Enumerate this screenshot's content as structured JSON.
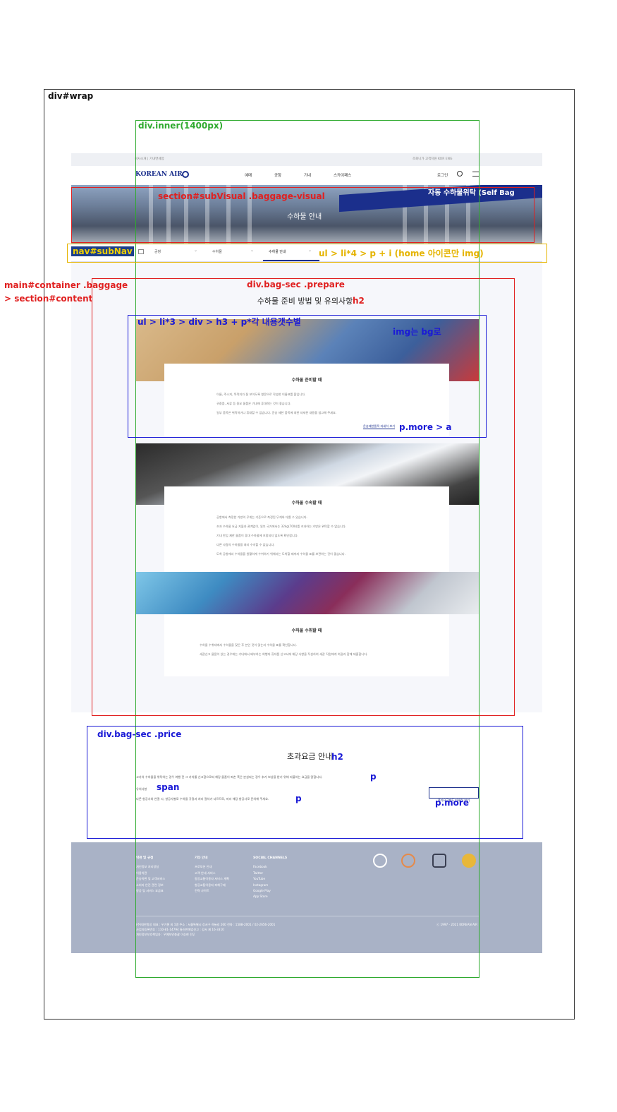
{
  "labels": {
    "wrap": "div#wrap",
    "inner": "div.inner(1400px)",
    "subvisual": "section#subVisual .baggage-visual",
    "subnav": "nav#subNav",
    "subnav_desc": "ul > li*4 > p + i (home 아이콘만 img)",
    "main_1": "main#container .baggage",
    "main_2": "> section#content",
    "prepare": "div.bag-sec .prepare",
    "list_desc": "ul > li*3 > div > h3 + p*각 내용갯수별",
    "img_bg": "img는 bg로",
    "h2_tag": "h2",
    "more_a": "p.more > a",
    "price": "div.bag-sec .price",
    "h2_tag2": "h2",
    "p_tag": "p",
    "span_tag": "span",
    "p_tag2": "p",
    "p_more": "p.more"
  },
  "page": {
    "topbar_left": "회사소개  |  기내면세점",
    "topbar_right": "조회니가  고객지원  KOR ENG",
    "logo": "KOREAN AIR",
    "nav": [
      "예매",
      "공항",
      "기내",
      "스카이패스"
    ],
    "login": "로그인",
    "visual_title": "수하물 안내",
    "visual_sign": "자동 수하물위탁 (Self Bag",
    "subnav_items": [
      "공항",
      "수하물",
      "수하물 안내"
    ],
    "prepare_title": "수하물 준비 방법 및 유의사항",
    "cards": [
      {
        "title": "수하물 준비할 때",
        "lines": [
          "이름, 주소지, 목적지가 잘 보이도록 영문으로 작성한 이름표를 붙입니다.",
          "귀중품, 서류 등 중요 물품은 기내에 휴대하는 것이 좋습니다.",
          "일부 품목은 위탁하거나 휴대할 수 없습니다. 운송 제한 품목에 대한 자세한 내용을 참고해 주세요."
        ],
        "more": "운송제한품목 자세히 보기"
      },
      {
        "title": "수하물 수속할 때",
        "lines": [
          "공항에서 측정한 가방의 무게는 기준으로 측정된 무게와 다를 수 있습니다.",
          "초과 수하물 요금 지불과 관계없이, 일부 국가에서는 32kg(70lb)를 초과하는 가방은 위탁할 수 없습니다.",
          "기내 반입 제한 물품이 휴대 수하물에 포함되지 않도록 확인합니다.",
          "다른 사람의 수하물을 대리 수속할 수 없습니다.",
          "도착 공항에서 수하물을 원활하게 수취하기 위해서는 도착할 때까지 수하물 표를 보관하는 것이 좋습니다."
        ]
      },
      {
        "title": "수하물 수취할 때",
        "lines": [
          "수하물 수취대에서 수하물을 찾은 후 본인 것이 맞는지 수하물 표를 확인합니다.",
          "세관신고 물품이 있는 경우에는 기내에서 배부하는 여행자 휴대품 신고서에 해당 사항을 작성하여 세관 직원에게 여권과 함께 제출합니다."
        ]
      }
    ],
    "price_title": "초과요금 안내",
    "price_p": "고가의 수하물을 위탁하는 경우 여행 전 그 가치를 신고함으로써 해당 물품이 파손 혹은 분실되는 경우 추가 보상을 받기 위해 지불하는 요금을 말합니다.",
    "price_span": "유의사항",
    "price_p2": "다른 항공사와 연결 시, 항공사별로 수하물 규정과 처리 절차가 다르므로, 미리 해당 항공사로 문의해 주세요.",
    "price_more": "종가요금제도 자세히 보기",
    "footer_cols": [
      {
        "head": "약관 및 규정",
        "items": [
          "개인정보 처리방침",
          "이용약관",
          "운송약관 및 고객서비스",
          "소비자 안전 관련 정보",
          "항공 및 서비스 요금표"
        ]
      },
      {
        "head": "기타 안내",
        "items": [
          "프로모션 안내",
          "고객 안내 서비스",
          "항공교통이용자 서비스 계획",
          "항공교통이용자 피해구제",
          "전략 사이트"
        ]
      },
      {
        "head": "SOCIAL CHANNELS",
        "items": [
          "Facebook",
          "Twitter",
          "YouTube",
          "Instagram",
          "Google Play",
          "App Store"
        ]
      }
    ],
    "footer_copy": "ⓒ 1997 - 2021 KOREAN AIR",
    "footer_addr": [
      "(주)대한항공  대표 : 우기홍 외 1명  주소 : 서울특별시 강서구 하늘길 260  전화 : 1588-2001 / 02-2656-2001",
      "사업자등록번호 : 110-81-14794  통신판매업신고 : 강서 제 16-3310",
      "개인정보보호책임자 : 우예보안총괄 이승현 전무"
    ]
  },
  "colors": {
    "red": "#e02020",
    "blue": "#1a1ad6",
    "yellow": "#e5b400",
    "green": "#2faa2f",
    "footer": "#a9b2c6"
  }
}
